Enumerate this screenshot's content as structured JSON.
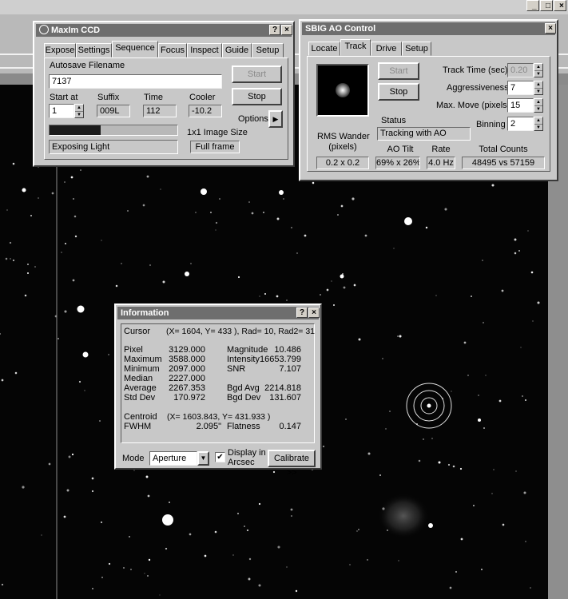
{
  "window_controls": {
    "minimize": "_",
    "maximize": "□",
    "close": "×"
  },
  "maxim": {
    "title": "MaxIm CCD",
    "help": "?",
    "close": "×",
    "tabs": [
      "Expose",
      "Settings",
      "Sequence",
      "Focus",
      "Inspect",
      "Guide",
      "Setup"
    ],
    "active_tab": "Sequence",
    "autosave_label": "Autosave Filename",
    "autosave_value": "7137",
    "start_label": "Start",
    "stop_label": "Stop",
    "start_at_label": "Start at",
    "start_at_value": "1",
    "suffix_label": "Suffix",
    "suffix_value": "009L",
    "time_label": "Time",
    "time_value": "112",
    "cooler_label": "Cooler",
    "cooler_value": "-10.2",
    "options_label": "Options",
    "options_arrow": "▶",
    "progress_fraction": 0.4,
    "status_value": "Exposing Light",
    "image_size_label": "1x1 Image Size",
    "image_size_value": "Full frame"
  },
  "sbig": {
    "title": "SBIG AO Control",
    "close": "×",
    "tabs": [
      "Locate",
      "Track",
      "Drive",
      "Setup"
    ],
    "active_tab": "Track",
    "start_label": "Start",
    "stop_label": "Stop",
    "track_time_label": "Track Time (sec)",
    "track_time_value": "0.20",
    "aggressiveness_label": "Aggressiveness",
    "aggressiveness_value": "7",
    "max_move_label": "Max. Move (pixels)",
    "max_move_value": "15",
    "binning_label": "Binning",
    "binning_value": "2",
    "status_label": "Status",
    "status_value": "Tracking with AO",
    "rms_label_1": "RMS Wander",
    "rms_label_2": "(pixels)",
    "rms_value": "0.2 x 0.2",
    "ao_tilt_label": "AO Tilt",
    "ao_tilt_value": "69% x 26%",
    "rate_label": "Rate",
    "rate_value": "4.0 Hz",
    "total_counts_label": "Total Counts",
    "total_counts_value": "48495 vs 57159"
  },
  "info": {
    "title": "Information",
    "help": "?",
    "close": "×",
    "cursor_label": "Cursor",
    "cursor_value": "(X= 1604, Y=  433 ), Rad= 10, Rad2= 31",
    "stats_left": [
      {
        "label": "Pixel",
        "value": "3129.000"
      },
      {
        "label": "Maximum",
        "value": "3588.000"
      },
      {
        "label": "Minimum",
        "value": "2097.000"
      },
      {
        "label": "Median",
        "value": "2227.000"
      },
      {
        "label": "Average",
        "value": "2267.353"
      },
      {
        "label": "Std Dev",
        "value": "170.972"
      }
    ],
    "stats_right": [
      {
        "label": "Magnitude",
        "value": "10.486"
      },
      {
        "label": "Intensity",
        "value": "16653.799"
      },
      {
        "label": "SNR",
        "value": "7.107"
      },
      {
        "label": "Bgd Avg",
        "value": "2214.818"
      },
      {
        "label": "Bgd Dev",
        "value": "131.607"
      }
    ],
    "centroid_label": "Centroid",
    "centroid_value": "(X= 1603.843, Y=  431.933 )",
    "fwhm_label": "FWHM",
    "fwhm_value": "2.095\"",
    "flatness_label": "Flatness",
    "flatness_value": "0.147",
    "mode_label": "Mode",
    "mode_value": "Aperture",
    "dropdown_arrow": "▼",
    "display_arcsec_label_1": "Display in",
    "display_arcsec_label_2": "Arcsec",
    "display_arcsec_checked": true,
    "check_mark": "✔",
    "calibrate_label": "Calibrate >>"
  }
}
